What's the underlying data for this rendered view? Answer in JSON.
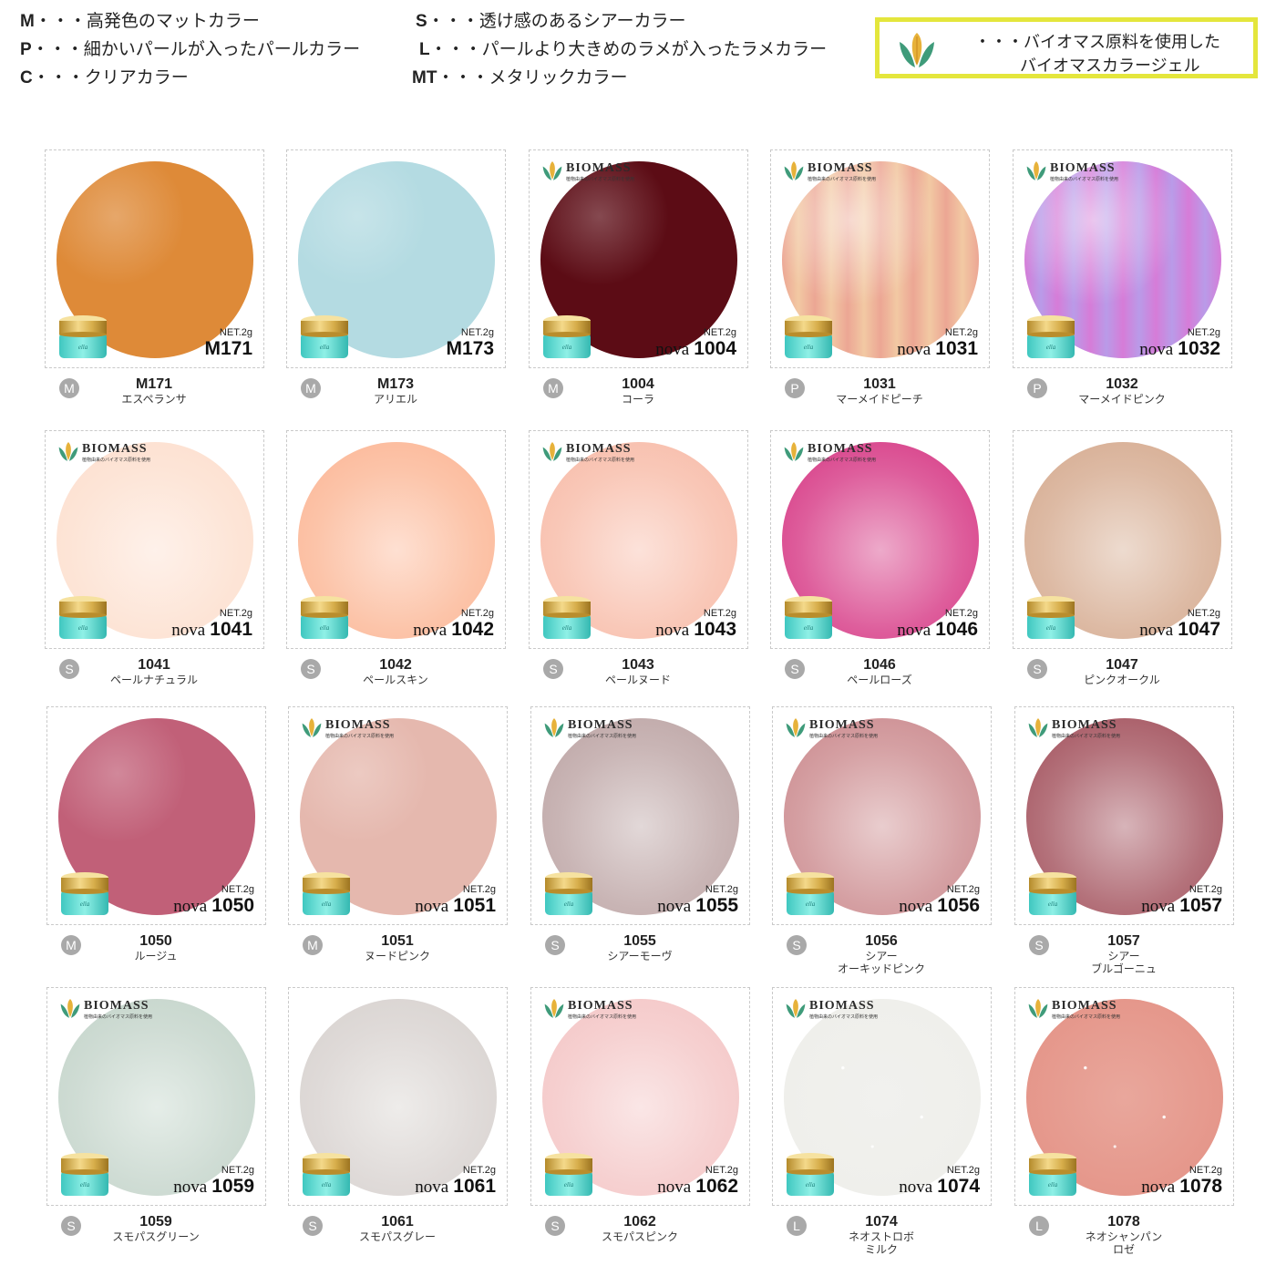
{
  "legend": {
    "items": [
      {
        "code": "M",
        "desc": "・・・高発色のマットカラー"
      },
      {
        "code": "P",
        "desc": "・・・細かいパールが入ったパールカラー"
      },
      {
        "code": "C",
        "desc": "・・・クリアカラー"
      },
      {
        "code": "S",
        "desc": "・・・透け感のあるシアーカラー"
      },
      {
        "code": "L",
        "desc": "・・・パールより大きめのラメが入ったラメカラー"
      },
      {
        "code": "MT",
        "desc": "・・・メタリックカラー"
      }
    ],
    "biomass_note_line1": "・・・バイオマス原料を使用した",
    "biomass_note_line2": "バイオマスカラージェル"
  },
  "biomass_label": "BIOMASS",
  "biomass_sublabel": "植物由来のバイオマス原料を使用",
  "net_label": "NET.2g",
  "brand_prefix": "nova",
  "products": [
    {
      "code": "M171",
      "label_prefix": "",
      "type": "M",
      "name": "エスペランサ",
      "color": "#de8a38",
      "biomass": false,
      "finish": "matte"
    },
    {
      "code": "M173",
      "label_prefix": "",
      "type": "M",
      "name": "アリエル",
      "color": "#b4dbe2",
      "biomass": false,
      "finish": "matte"
    },
    {
      "code": "1004",
      "label_prefix": "nova",
      "type": "M",
      "name": "コーラ",
      "color": "#5c0c15",
      "biomass": true,
      "finish": "matte"
    },
    {
      "code": "1031",
      "label_prefix": "nova",
      "type": "P",
      "name": "マーメイドピーチ",
      "color": "#eca694",
      "color2": "#f2c9a3",
      "biomass": true,
      "finish": "pearl"
    },
    {
      "code": "1032",
      "label_prefix": "nova",
      "type": "P",
      "name": "マーメイドピンク",
      "color": "#d67cd8",
      "color2": "#b99be8",
      "biomass": true,
      "finish": "pearl"
    },
    {
      "code": "1041",
      "label_prefix": "nova",
      "type": "S",
      "name": "ペールナチュラル",
      "color": "#fde0d0",
      "biomass": true,
      "finish": "sheer"
    },
    {
      "code": "1042",
      "label_prefix": "nova",
      "type": "S",
      "name": "ペールスキン",
      "color": "#fcb99a",
      "biomass": false,
      "finish": "sheer"
    },
    {
      "code": "1043",
      "label_prefix": "nova",
      "type": "S",
      "name": "ペールヌード",
      "color": "#f8beac",
      "biomass": true,
      "finish": "sheer"
    },
    {
      "code": "1046",
      "label_prefix": "nova",
      "type": "S",
      "name": "ペールローズ",
      "color": "#d8428a",
      "biomass": true,
      "finish": "sheer"
    },
    {
      "code": "1047",
      "label_prefix": "nova",
      "type": "S",
      "name": "ピンクオークル",
      "color": "#d7ae94",
      "biomass": false,
      "finish": "sheer"
    },
    {
      "code": "1050",
      "label_prefix": "nova",
      "type": "M",
      "name": "ルージュ",
      "color": "#c16078",
      "biomass": false,
      "finish": "matte"
    },
    {
      "code": "1051",
      "label_prefix": "nova",
      "type": "M",
      "name": "ヌードピンク",
      "color": "#e5b8ae",
      "biomass": true,
      "finish": "matte"
    },
    {
      "code": "1055",
      "label_prefix": "nova",
      "type": "S",
      "name": "シアーモーヴ",
      "color": "#bfa8a8",
      "biomass": true,
      "finish": "sheer"
    },
    {
      "code": "1056",
      "label_prefix": "nova",
      "type": "S",
      "name": "シアー\nオーキッドピンク",
      "color": "#cd8f93",
      "biomass": true,
      "finish": "sheer"
    },
    {
      "code": "1057",
      "label_prefix": "nova",
      "type": "S",
      "name": "シアー\nブルゴーニュ",
      "color": "#a75964",
      "biomass": true,
      "finish": "sheer"
    },
    {
      "code": "1059",
      "label_prefix": "nova",
      "type": "S",
      "name": "スモパスグリーン",
      "color": "#c6d6cc",
      "biomass": true,
      "finish": "sheer"
    },
    {
      "code": "1061",
      "label_prefix": "nova",
      "type": "S",
      "name": "スモパスグレー",
      "color": "#d9d4d1",
      "biomass": false,
      "finish": "sheer"
    },
    {
      "code": "1062",
      "label_prefix": "nova",
      "type": "S",
      "name": "スモパスピンク",
      "color": "#f4c8c8",
      "biomass": true,
      "finish": "sheer"
    },
    {
      "code": "1074",
      "label_prefix": "nova",
      "type": "L",
      "name": "ネオストロボ\nミルク",
      "color": "#efefeb",
      "biomass": true,
      "finish": "glitter"
    },
    {
      "code": "1078",
      "label_prefix": "nova",
      "type": "L",
      "name": "ネオシャンパン\nロゼ",
      "color": "#e5978b",
      "biomass": true,
      "finish": "glitter"
    }
  ]
}
